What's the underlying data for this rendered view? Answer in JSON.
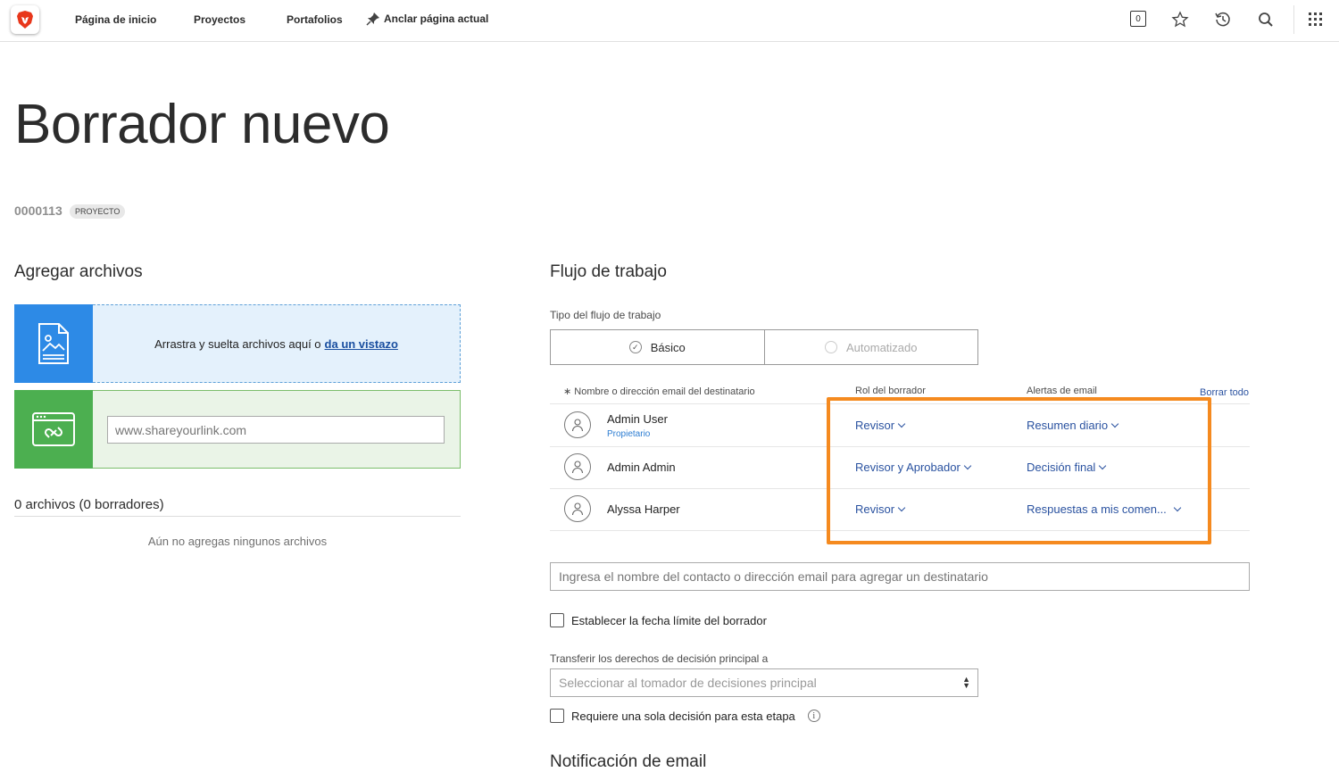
{
  "topbar": {
    "nav": [
      "Página de inicio",
      "Proyectos",
      "Portafolios"
    ],
    "pin_label": "Anclar página actual",
    "notification_count": "0"
  },
  "page": {
    "title": "Borrador nuevo",
    "ref_number": "0000113",
    "ref_type": "PROYECTO"
  },
  "files": {
    "heading": "Agregar archivos",
    "drop_text": "Arrastra y suelta archivos aquí o",
    "drop_link": "da un vistazo",
    "link_placeholder": "www.shareyourlink.com",
    "count_text": "0 archivos (0 borradores)",
    "empty_text": "Aún no agregas ningunos archivos"
  },
  "workflow": {
    "heading": "Flujo de trabajo",
    "type_label": "Tipo del flujo de trabajo",
    "type_options": [
      "Básico",
      "Automatizado"
    ],
    "selected_type": "Básico",
    "columns": {
      "recipient": "∗ Nombre o dirección email del destinatario",
      "role": "Rol del borrador",
      "alerts": "Alertas de email",
      "clear_all": "Borrar todo"
    },
    "recipients": [
      {
        "name": "Admin User",
        "subtitle": "Propietario",
        "role": "Revisor",
        "alert": "Resumen diario"
      },
      {
        "name": "Admin Admin",
        "role": "Revisor y Aprobador",
        "alert": "Decisión final"
      },
      {
        "name": "Alyssa Harper",
        "role": "Revisor",
        "alert": "Respuestas a mis comen..."
      }
    ],
    "highlight_color": "#f58a1f",
    "add_placeholder": "Ingresa el nombre del contacto o dirección email para agregar un destinatario",
    "deadline_label": "Establecer la fecha límite del borrador",
    "transfer_label": "Transferir los derechos de decisión principal a",
    "transfer_placeholder": "Seleccionar al tomador de decisiones principal",
    "single_decision_label": "Requiere una sola decisión para esta etapa",
    "next_heading": "Notificación de email"
  }
}
